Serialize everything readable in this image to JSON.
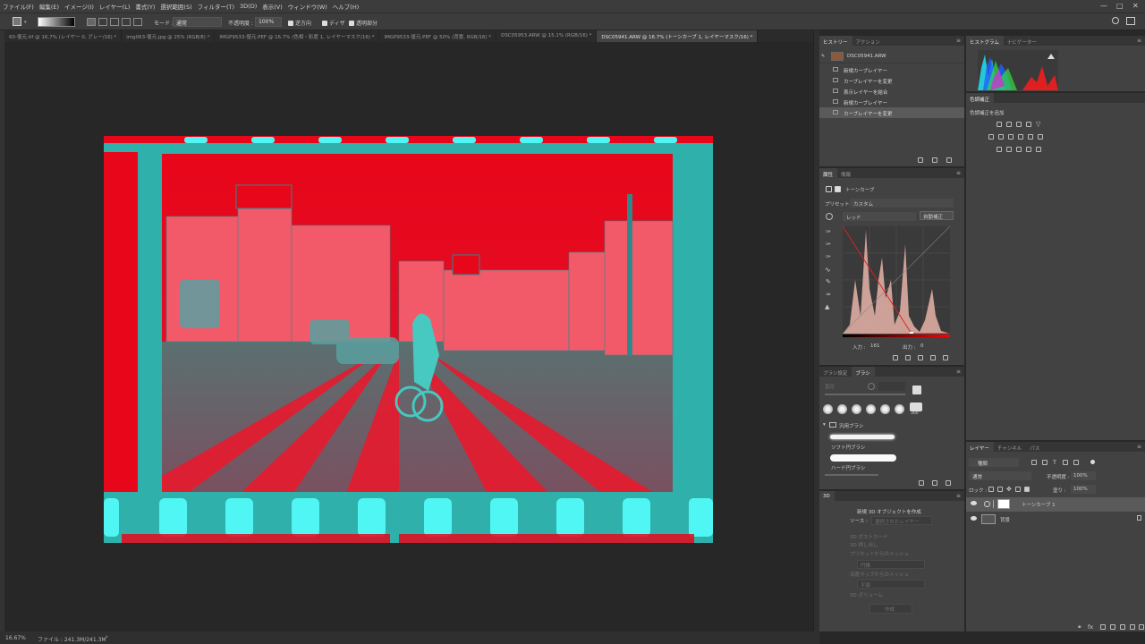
{
  "menu": [
    "ファイル(F)",
    "編集(E)",
    "イメージ(I)",
    "レイヤー(L)",
    "書式(Y)",
    "選択範囲(S)",
    "フィルター(T)",
    "3D(D)",
    "表示(V)",
    "ウィンドウ(W)",
    "ヘルプ(H)"
  ],
  "options": {
    "mode_label": "モード :",
    "mode_value": "通常",
    "opacity_label": "不透明度 :",
    "opacity_value": "100%",
    "reverse": "逆方向",
    "dither": "ディザ",
    "transparency": "透明部分"
  },
  "tabs": [
    "60-復元.tif @ 16.7% (レイヤー 0, グレー/16) *",
    "img063-復元.jpg @ 25% (RGB/8) *",
    "IMGP9533-復元.PEF @ 16.7% (色相・彩度 1, レイヤーマスク/16) *",
    "IMGP9533-復元.PEF @ 50% (背景, RGB/16) *",
    "DSC05953.ARW @ 15.1% (RGB/16) *",
    "DSC05941.ARW @ 16.7% (トーンカーブ 1, レイヤーマスク/16) *"
  ],
  "status": {
    "zoom": "16.67%",
    "file": "ファイル : 241.3M/241.3M"
  },
  "history": {
    "tabs": [
      "ヒストリー",
      "アクション"
    ],
    "snapshot": "DSC05941.ARW",
    "items": [
      "新規カーブレイヤー",
      "カーブレイヤーを変更",
      "表示レイヤーを結合",
      "新規カーブレイヤー",
      "カーブレイヤーを変更"
    ]
  },
  "histogram": {
    "tabs": [
      "ヒストグラム",
      "ナビゲーター"
    ]
  },
  "adjust": {
    "tabs": [
      "色調補正"
    ],
    "title": "色調補正を追加"
  },
  "properties": {
    "tabs": [
      "属性",
      "情報"
    ],
    "title": "トーンカーブ",
    "preset_label": "プリセット :",
    "preset_value": "カスタム",
    "channel": "レッド",
    "auto": "自動補正",
    "input_label": "入力 :",
    "input_value": "161",
    "output_label": "出力 :",
    "output_value": "0"
  },
  "brush": {
    "tabs": [
      "ブラシ設定",
      "ブラシ"
    ],
    "size_label": "直径",
    "size_value": "300",
    "group": "汎用ブラシ",
    "items": [
      "ソフト円ブラシ",
      "ハード円ブラシ"
    ]
  },
  "threed": {
    "tab": "3D",
    "new_label": "新規 3D オブジェクトを作成",
    "source_label": "ソース :",
    "source_value": "選択されたレイヤー",
    "options": [
      "3D ポストカード",
      "3D 押し出し",
      "プリセットからのメッシュ",
      "円錐",
      "深度マップからのメッシュ",
      "平面",
      "3D ボリューム"
    ],
    "create": "作成"
  },
  "layers": {
    "tabs": [
      "レイヤー",
      "チャンネル",
      "パス"
    ],
    "filter_label": "種類",
    "blend": "通常",
    "opacity_label": "不透明度 :",
    "opacity_value": "100%",
    "lock_label": "ロック :",
    "fill_label": "塗り :",
    "fill_value": "100%",
    "items": [
      "トーンカーブ 1",
      "背景"
    ]
  },
  "colors": {
    "accent": "#5a5a5a",
    "panel": "#424242",
    "canvas": "#272727"
  }
}
